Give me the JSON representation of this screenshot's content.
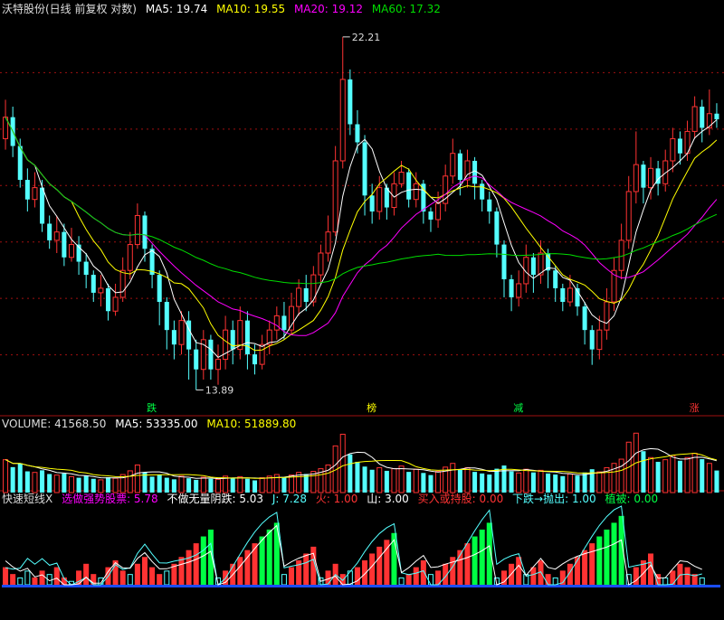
{
  "header": {
    "title": "沃特股份(日线 前复权 对数)",
    "ma5": "MA5: 19.74",
    "ma10": "MA10: 19.55",
    "ma20": "MA20: 19.12",
    "ma60": "MA60: 17.32"
  },
  "volume_header": {
    "label": "VOLUME: 41568.50",
    "ma5": "MA5: 53335.00",
    "ma10": "MA10: 51889.80"
  },
  "indicator_header": {
    "name": "快速短线X",
    "strong": "选做强势股票: 5.78",
    "nodrop": "不做无量阴跌: 5.03",
    "j": "J: 7.28",
    "huo": "火: 1.00",
    "shan": "山: 3.00",
    "buy": "买入或持股: 0.00",
    "sell": "下跌→抛出: 1.00",
    "zhibei": "植被: 0.00"
  },
  "colors": {
    "up": "#ff3333",
    "down": "#54ffff",
    "ma5": "#ffffff",
    "ma10": "#ffff00",
    "ma20": "#ff00ff",
    "ma60": "#00dd00",
    "grid": "#a01010",
    "green": "#00ff44",
    "blue": "#1a4dff"
  },
  "chart_data": [
    {
      "type": "candlestick",
      "title": "沃特股份(日线 前复权 对数)",
      "annotations": {
        "high": "22.21",
        "low": "13.89"
      },
      "markers": [
        "跌",
        "榜",
        "减",
        "涨"
      ],
      "candles": [
        [
          19.2,
          19.8,
          20.3,
          18.9
        ],
        [
          19.8,
          19.0,
          20.1,
          18.7
        ],
        [
          19.0,
          18.1,
          19.2,
          17.9
        ],
        [
          18.1,
          17.6,
          18.4,
          17.3
        ],
        [
          17.6,
          17.9,
          18.3,
          17.4
        ],
        [
          17.9,
          17.0,
          18.1,
          16.8
        ],
        [
          17.0,
          16.6,
          17.2,
          16.4
        ],
        [
          16.6,
          16.8,
          17.2,
          16.3
        ],
        [
          16.8,
          16.2,
          17.0,
          16.0
        ],
        [
          16.2,
          16.5,
          16.9,
          16.1
        ],
        [
          16.5,
          16.1,
          16.7,
          15.8
        ],
        [
          16.1,
          15.8,
          16.3,
          15.5
        ],
        [
          15.8,
          15.4,
          15.9,
          15.2
        ],
        [
          15.4,
          15.5,
          15.8,
          15.1
        ],
        [
          15.5,
          15.0,
          15.6,
          14.8
        ],
        [
          15.0,
          15.3,
          15.6,
          14.9
        ],
        [
          15.3,
          15.9,
          16.2,
          15.2
        ],
        [
          15.9,
          16.5,
          16.8,
          15.7
        ],
        [
          16.5,
          17.2,
          17.5,
          16.4
        ],
        [
          17.2,
          16.4,
          17.3,
          16.1
        ],
        [
          16.4,
          15.8,
          16.5,
          15.5
        ],
        [
          15.8,
          15.2,
          15.9,
          14.7
        ],
        [
          15.2,
          14.6,
          15.3,
          14.2
        ],
        [
          14.6,
          14.3,
          14.8,
          14.0
        ],
        [
          14.3,
          14.8,
          15.0,
          14.1
        ],
        [
          14.8,
          14.2,
          15.0,
          13.6
        ],
        [
          14.2,
          13.8,
          14.4,
          13.4
        ],
        [
          13.8,
          14.4,
          14.6,
          13.6
        ],
        [
          14.4,
          13.8,
          14.5,
          13.6
        ],
        [
          13.8,
          14.0,
          14.3,
          13.5
        ],
        [
          14.0,
          14.6,
          14.9,
          13.8
        ],
        [
          14.6,
          14.2,
          14.8,
          13.9
        ],
        [
          14.2,
          14.8,
          15.1,
          14.0
        ],
        [
          14.8,
          14.1,
          15.0,
          13.8
        ],
        [
          14.1,
          13.9,
          14.3,
          13.7
        ],
        [
          13.9,
          14.3,
          14.5,
          13.8
        ],
        [
          14.3,
          14.6,
          14.8,
          14.1
        ],
        [
          14.6,
          14.9,
          15.1,
          14.4
        ],
        [
          14.9,
          14.6,
          15.2,
          14.4
        ],
        [
          14.6,
          15.1,
          15.4,
          14.5
        ],
        [
          15.1,
          15.5,
          15.7,
          14.9
        ],
        [
          15.5,
          15.2,
          15.8,
          15.0
        ],
        [
          15.2,
          15.8,
          16.0,
          15.1
        ],
        [
          15.8,
          16.3,
          16.5,
          15.6
        ],
        [
          16.3,
          16.8,
          17.2,
          16.1
        ],
        [
          16.8,
          18.6,
          19.0,
          16.7
        ],
        [
          18.6,
          20.9,
          22.21,
          18.4
        ],
        [
          20.9,
          19.6,
          21.2,
          19.3
        ],
        [
          19.6,
          19.1,
          20.0,
          18.8
        ],
        [
          19.1,
          17.7,
          19.3,
          17.2
        ],
        [
          17.7,
          17.3,
          18.0,
          17.0
        ],
        [
          17.3,
          17.9,
          18.2,
          17.1
        ],
        [
          17.9,
          17.4,
          18.0,
          17.1
        ],
        [
          17.4,
          18.0,
          18.3,
          17.2
        ],
        [
          18.0,
          18.3,
          18.6,
          17.9
        ],
        [
          18.3,
          17.6,
          18.4,
          17.4
        ],
        [
          17.6,
          18.0,
          18.3,
          17.4
        ],
        [
          18.0,
          17.3,
          18.1,
          17.0
        ],
        [
          17.3,
          17.1,
          17.4,
          16.8
        ],
        [
          17.1,
          17.5,
          17.8,
          16.9
        ],
        [
          17.5,
          18.2,
          18.5,
          17.3
        ],
        [
          18.2,
          18.8,
          19.2,
          18.0
        ],
        [
          18.8,
          18.1,
          18.9,
          17.7
        ],
        [
          18.1,
          18.6,
          18.9,
          17.9
        ],
        [
          18.6,
          18.0,
          18.7,
          17.6
        ],
        [
          18.0,
          17.6,
          18.1,
          17.3
        ],
        [
          17.6,
          17.3,
          17.8,
          17.0
        ],
        [
          17.3,
          16.5,
          17.4,
          16.2
        ],
        [
          16.5,
          15.7,
          16.6,
          15.3
        ],
        [
          15.7,
          15.3,
          15.8,
          15.0
        ],
        [
          15.3,
          15.6,
          15.9,
          15.1
        ],
        [
          15.6,
          16.2,
          16.5,
          15.4
        ],
        [
          16.2,
          15.8,
          16.3,
          15.4
        ],
        [
          15.8,
          16.3,
          16.6,
          15.6
        ],
        [
          16.3,
          15.9,
          16.4,
          15.5
        ],
        [
          15.9,
          15.5,
          16.0,
          15.2
        ],
        [
          15.5,
          15.2,
          15.6,
          15.0
        ],
        [
          15.2,
          15.5,
          15.8,
          15.1
        ],
        [
          15.5,
          15.1,
          15.6,
          14.9
        ],
        [
          15.1,
          14.6,
          15.2,
          14.3
        ],
        [
          14.6,
          14.2,
          14.7,
          13.89
        ],
        [
          14.2,
          14.6,
          14.9,
          14.0
        ],
        [
          14.6,
          15.2,
          15.5,
          14.4
        ],
        [
          15.2,
          15.9,
          16.2,
          15.0
        ],
        [
          15.9,
          16.6,
          17.0,
          15.7
        ],
        [
          16.6,
          17.8,
          18.2,
          16.4
        ],
        [
          17.8,
          18.5,
          19.4,
          17.5
        ],
        [
          18.5,
          17.9,
          18.6,
          17.5
        ],
        [
          17.9,
          18.4,
          18.7,
          17.6
        ],
        [
          18.4,
          18.0,
          18.6,
          17.7
        ],
        [
          18.0,
          18.6,
          18.9,
          17.8
        ],
        [
          18.6,
          19.2,
          19.5,
          18.3
        ],
        [
          19.2,
          18.8,
          19.4,
          18.5
        ],
        [
          18.8,
          19.4,
          19.7,
          18.6
        ],
        [
          19.4,
          20.1,
          20.4,
          19.2
        ],
        [
          20.1,
          19.5,
          20.3,
          19.1
        ],
        [
          19.5,
          19.9,
          20.6,
          19.3
        ],
        [
          19.9,
          19.74,
          20.2,
          19.5
        ]
      ],
      "volume": [
        62,
        48,
        55,
        40,
        38,
        42,
        35,
        33,
        36,
        30,
        28,
        32,
        26,
        24,
        29,
        27,
        34,
        41,
        52,
        38,
        30,
        34,
        28,
        25,
        31,
        27,
        24,
        29,
        26,
        25,
        31,
        27,
        30,
        26,
        23,
        28,
        31,
        34,
        29,
        33,
        38,
        35,
        40,
        45,
        52,
        88,
        110,
        72,
        58,
        49,
        43,
        47,
        41,
        45,
        50,
        39,
        44,
        37,
        33,
        40,
        48,
        55,
        43,
        47,
        39,
        36,
        34,
        45,
        51,
        40,
        37,
        44,
        38,
        42,
        36,
        34,
        31,
        35,
        32,
        38,
        44,
        39,
        47,
        55,
        63,
        95,
        112,
        78,
        66,
        58,
        62,
        70,
        60,
        66,
        74,
        63,
        55,
        41.6
      ],
      "indicator_bars": [
        5,
        3,
        -2,
        -4,
        2,
        4,
        -3,
        5,
        2,
        -1,
        4,
        6,
        3,
        -2,
        5,
        7,
        4,
        -3,
        6,
        8,
        5,
        3,
        -4,
        6,
        8,
        10,
        12,
        14,
        16,
        -2,
        4,
        6,
        8,
        10,
        12,
        14,
        16,
        18,
        -3,
        5,
        7,
        9,
        11,
        -2,
        4,
        6,
        3,
        -4,
        5,
        7,
        9,
        11,
        13,
        15,
        -2,
        3,
        5,
        7,
        -3,
        4,
        6,
        8,
        10,
        12,
        14,
        16,
        18,
        -2,
        4,
        6,
        8,
        -3,
        5,
        7,
        3,
        -2,
        4,
        6,
        8,
        10,
        12,
        14,
        16,
        18,
        20,
        -3,
        5,
        7,
        9,
        3,
        -2,
        4,
        6,
        5,
        3,
        -2
      ]
    }
  ]
}
